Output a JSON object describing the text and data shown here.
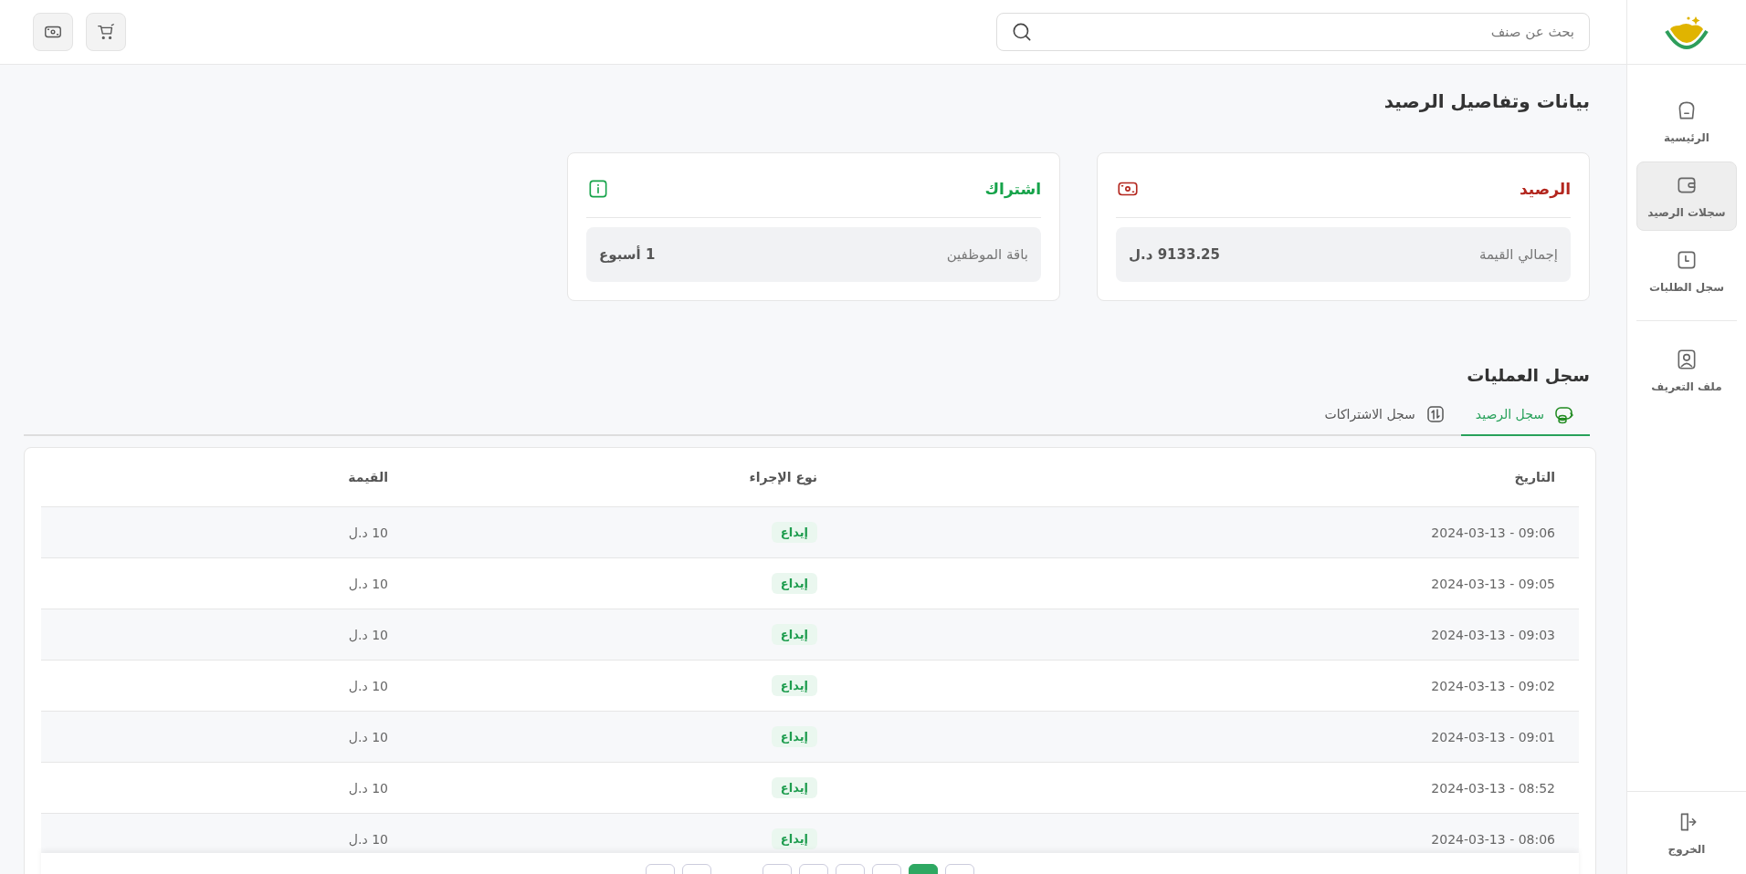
{
  "search": {
    "placeholder": "بحث عن صنف"
  },
  "sidebar": {
    "items": [
      {
        "label": "الرئيسية",
        "selected": false
      },
      {
        "label": "سجلات الرصيد",
        "selected": true
      },
      {
        "label": "سجل الطلبات",
        "selected": false
      },
      {
        "label": "ملف التعريف",
        "selected": false
      }
    ],
    "logout": "الخروج"
  },
  "page_title": "بيانات وتفاصيل الرصيد",
  "cards": [
    {
      "title": "الرصيد",
      "color": "#b3261e",
      "label": "إجمالي القيمة",
      "value": "9133.25 د.ل"
    },
    {
      "title": "اشتراك",
      "color": "#16a34a",
      "label": "باقة الموظفين",
      "value": "1 أسبوع"
    }
  ],
  "section_title": "سجل العمليات",
  "tabs": [
    {
      "label": "سجل الرصيد",
      "selected": true
    },
    {
      "label": "سجل الاشتراكات",
      "selected": false
    }
  ],
  "table": {
    "columns": [
      "التاريخ",
      "نوع الإجراء",
      "القيمة"
    ],
    "rows": [
      [
        "09:06 - 2024-03-13",
        "إيداع",
        "10 د.ل"
      ],
      [
        "09:05 - 2024-03-13",
        "إيداع",
        "10 د.ل"
      ],
      [
        "09:03 - 2024-03-13",
        "إيداع",
        "10 د.ل"
      ],
      [
        "09:02 - 2024-03-13",
        "إيداع",
        "10 د.ل"
      ],
      [
        "09:01 - 2024-03-13",
        "إيداع",
        "10 د.ل"
      ],
      [
        "08:52 - 2024-03-13",
        "إيداع",
        "10 د.ل"
      ],
      [
        "08:06 - 2024-03-13",
        "إيداع",
        "10 د.ل"
      ]
    ]
  },
  "pagination": [
    {
      "selected": true
    },
    {
      "selected": false
    },
    {
      "selected": false
    },
    {
      "selected": false
    },
    {
      "selected": false
    },
    {
      "selected": false
    }
  ]
}
